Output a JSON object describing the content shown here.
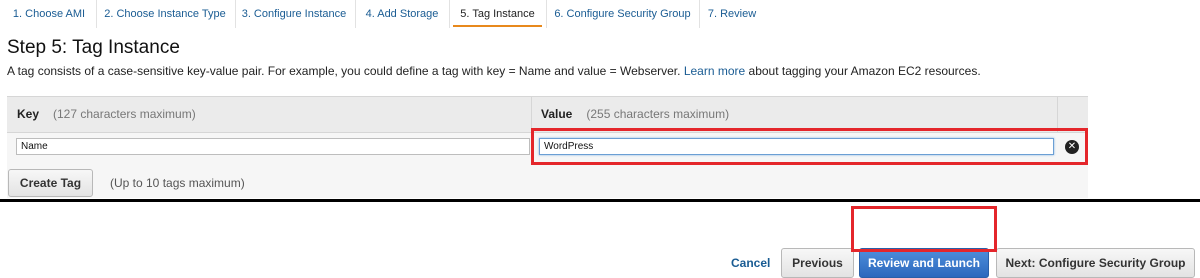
{
  "tabs": [
    {
      "label": "1. Choose AMI"
    },
    {
      "label": "2. Choose Instance Type"
    },
    {
      "label": "3. Configure Instance"
    },
    {
      "label": "4. Add Storage"
    },
    {
      "label": "5. Tag Instance"
    },
    {
      "label": "6. Configure Security Group"
    },
    {
      "label": "7. Review"
    }
  ],
  "page": {
    "title": "Step 5: Tag Instance",
    "desc_before": "A tag consists of a case-sensitive key-value pair. For example, you could define a tag with key = Name and value = Webserver.",
    "learn_more": "Learn more",
    "desc_after": "about tagging your Amazon EC2 resources."
  },
  "table": {
    "key_header": "Key",
    "key_hint": "(127 characters maximum)",
    "value_header": "Value",
    "value_hint": "(255 characters maximum)",
    "row": {
      "key": "Name",
      "value": "WordPress"
    },
    "create_tag": "Create Tag",
    "create_hint": "(Up to 10 tags maximum)"
  },
  "footer": {
    "cancel": "Cancel",
    "previous": "Previous",
    "review_launch": "Review and Launch",
    "next": "Next: Configure Security Group"
  },
  "colors": {
    "accent": "#1a5c93",
    "primary_button": "#2c68bd",
    "highlight": "#e4262b",
    "active_tab": "#e8891c"
  }
}
